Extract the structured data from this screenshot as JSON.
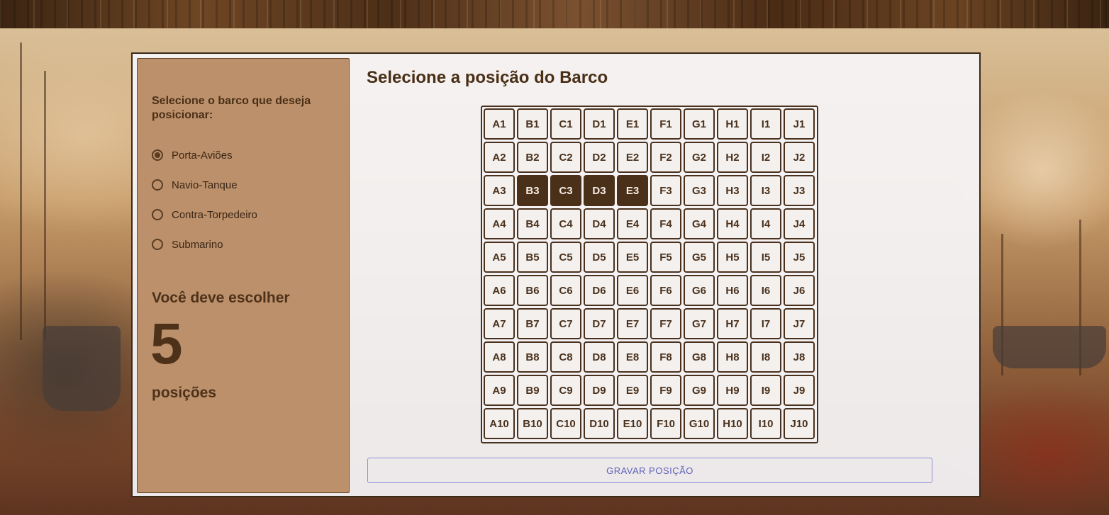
{
  "sidebar": {
    "title": "Selecione o barco que deseja posicionar:",
    "ships": [
      {
        "label": "Porta-Aviões",
        "checked": true
      },
      {
        "label": "Navio-Tanque",
        "checked": false
      },
      {
        "label": "Contra-Torpedeiro",
        "checked": false
      },
      {
        "label": "Submarino",
        "checked": false
      }
    ],
    "must_choose_label": "Você deve escolher",
    "positions_count": "5",
    "positions_label": "posições"
  },
  "board": {
    "title": "Selecione a posição do Barco",
    "columns": [
      "A",
      "B",
      "C",
      "D",
      "E",
      "F",
      "G",
      "H",
      "I",
      "J"
    ],
    "rows": [
      "1",
      "2",
      "3",
      "4",
      "5",
      "6",
      "7",
      "8",
      "9",
      "10"
    ],
    "selected_cells": [
      "B3",
      "C3",
      "D3",
      "E3"
    ]
  },
  "actions": {
    "save_label": "GRAVAR POSIÇÃO"
  },
  "colors": {
    "primary_brown": "#4b3019",
    "sidebar_bg": "#b68860",
    "button_accent": "#5e62b8"
  }
}
